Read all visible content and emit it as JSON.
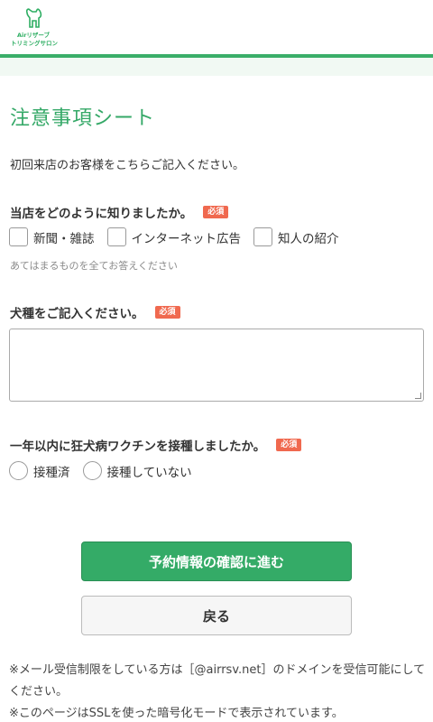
{
  "brand": {
    "line1": "Airリザーブ",
    "line2": "トリミングサロン",
    "color": "#2fae63"
  },
  "page": {
    "title": "注意事項シート",
    "intro": "初回来店のお客様をこちらご記入ください。"
  },
  "q1": {
    "label": "当店をどのように知りましたか。",
    "required": "必須",
    "options": [
      "新聞・雑誌",
      "インターネット広告",
      "知人の紹介"
    ],
    "hint": "あてはまるものを全てお答えください"
  },
  "q2": {
    "label": "犬種をご記入ください。",
    "required": "必須",
    "value": ""
  },
  "q3": {
    "label": "一年以内に狂犬病ワクチンを接種しましたか。",
    "required": "必須",
    "options": [
      "接種済",
      "接種していない"
    ]
  },
  "buttons": {
    "confirm": "予約情報の確認に進む",
    "back": "戻る"
  },
  "notes": [
    "※メール受信制限をしている方は［@airrsv.net］のドメインを受信可能にしてください。",
    "※このページはSSLを使った暗号化モードで表示されています。"
  ],
  "colors": {
    "accent": "#34a867",
    "required_badge": "#f0694f"
  }
}
